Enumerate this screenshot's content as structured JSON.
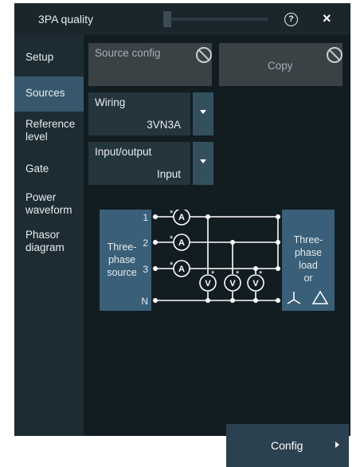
{
  "window": {
    "title": "3PA quality",
    "help_icon": "help-circle-icon",
    "close_icon": "close-icon",
    "help_glyph": "?",
    "close_glyph": "×"
  },
  "sidebar": {
    "items": [
      {
        "label": "Setup",
        "active": false
      },
      {
        "label": "Sources",
        "active": true
      },
      {
        "label": "Reference level",
        "active": false
      },
      {
        "label": "Gate",
        "active": false
      },
      {
        "label": "Power waveform",
        "active": false
      },
      {
        "label": "Phasor diagram",
        "active": false
      }
    ]
  },
  "main": {
    "source_config": {
      "label": "Source config",
      "icon": "disabled-icon"
    },
    "copy": {
      "label": "Copy",
      "icon": "disabled-icon"
    },
    "wiring": {
      "label": "Wiring",
      "value": "3VN3A"
    },
    "input_output": {
      "label": "Input/output",
      "value": "Input"
    },
    "diagram": {
      "source": [
        "Three-",
        "phase",
        "source"
      ],
      "load": [
        "Three-",
        "phase",
        "load",
        "or"
      ],
      "terminals": [
        "1",
        "2",
        "3",
        "N"
      ],
      "ammeter": "A",
      "voltmeter": "V",
      "polarity": "*"
    },
    "config_button": "Config"
  },
  "colors": {
    "accent": "#37586c",
    "background": "#121d22",
    "box": "#3a5f78"
  }
}
